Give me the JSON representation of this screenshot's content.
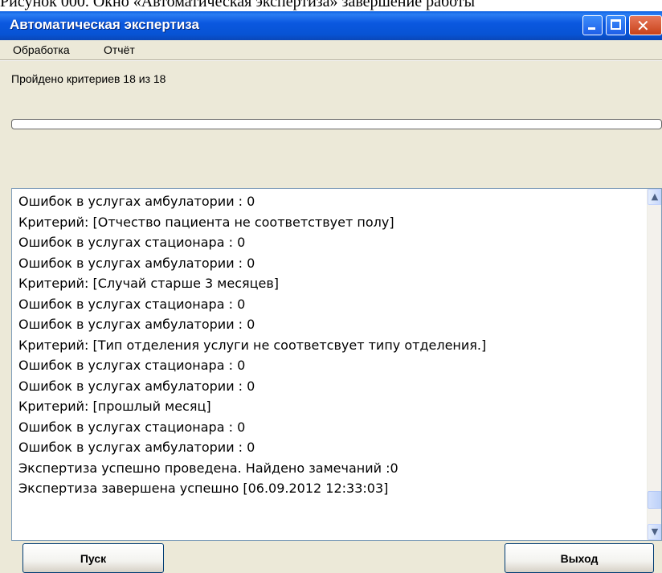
{
  "caption": {
    "text": "Рисунок 000. Окно «Автоматическая экспертиза» завершение работы"
  },
  "window": {
    "title": "Автоматическая экспертиза",
    "titlebar_color": "#0b58e0",
    "close_color": "#c8421a"
  },
  "menu": {
    "items": [
      {
        "label": "Обработка"
      },
      {
        "label": "Отчёт"
      }
    ]
  },
  "status": {
    "text": "Пройдено критериев 18 из 18"
  },
  "progress": {
    "fraction": 0
  },
  "log": {
    "lines": [
      "Ошибок в услугах амбулатории : 0",
      "Критерий: [Отчество пациента не соответствует полу]",
      "Ошибок в услугах стационара  : 0",
      "Ошибок в услугах амбулатории : 0",
      "Критерий: [Случай старше 3 месяцев]",
      "Ошибок в услугах стационара  : 0",
      "Ошибок в услугах амбулатории : 0",
      "Критерий: [Тип отделения услуги не соответсвует типу отделения.]",
      "Ошибок в услугах стационара  : 0",
      "Ошибок в услугах амбулатории : 0",
      "Критерий: [прошлый месяц]",
      "Ошибок в услугах стационара  : 0",
      "Ошибок в услугах амбулатории : 0",
      "Экспертиза успешно проведена. Найдено замечаний :0",
      "Экспертиза завершена успешно [06.09.2012 12:33:03]"
    ]
  },
  "buttons": {
    "start_label": "Пуск",
    "exit_label": "Выход"
  },
  "icons": {
    "minimize": "minimize-icon",
    "maximize": "maximize-icon",
    "close": "close-icon",
    "scroll_up": "chevron-up-icon",
    "scroll_down": "chevron-down-icon"
  }
}
